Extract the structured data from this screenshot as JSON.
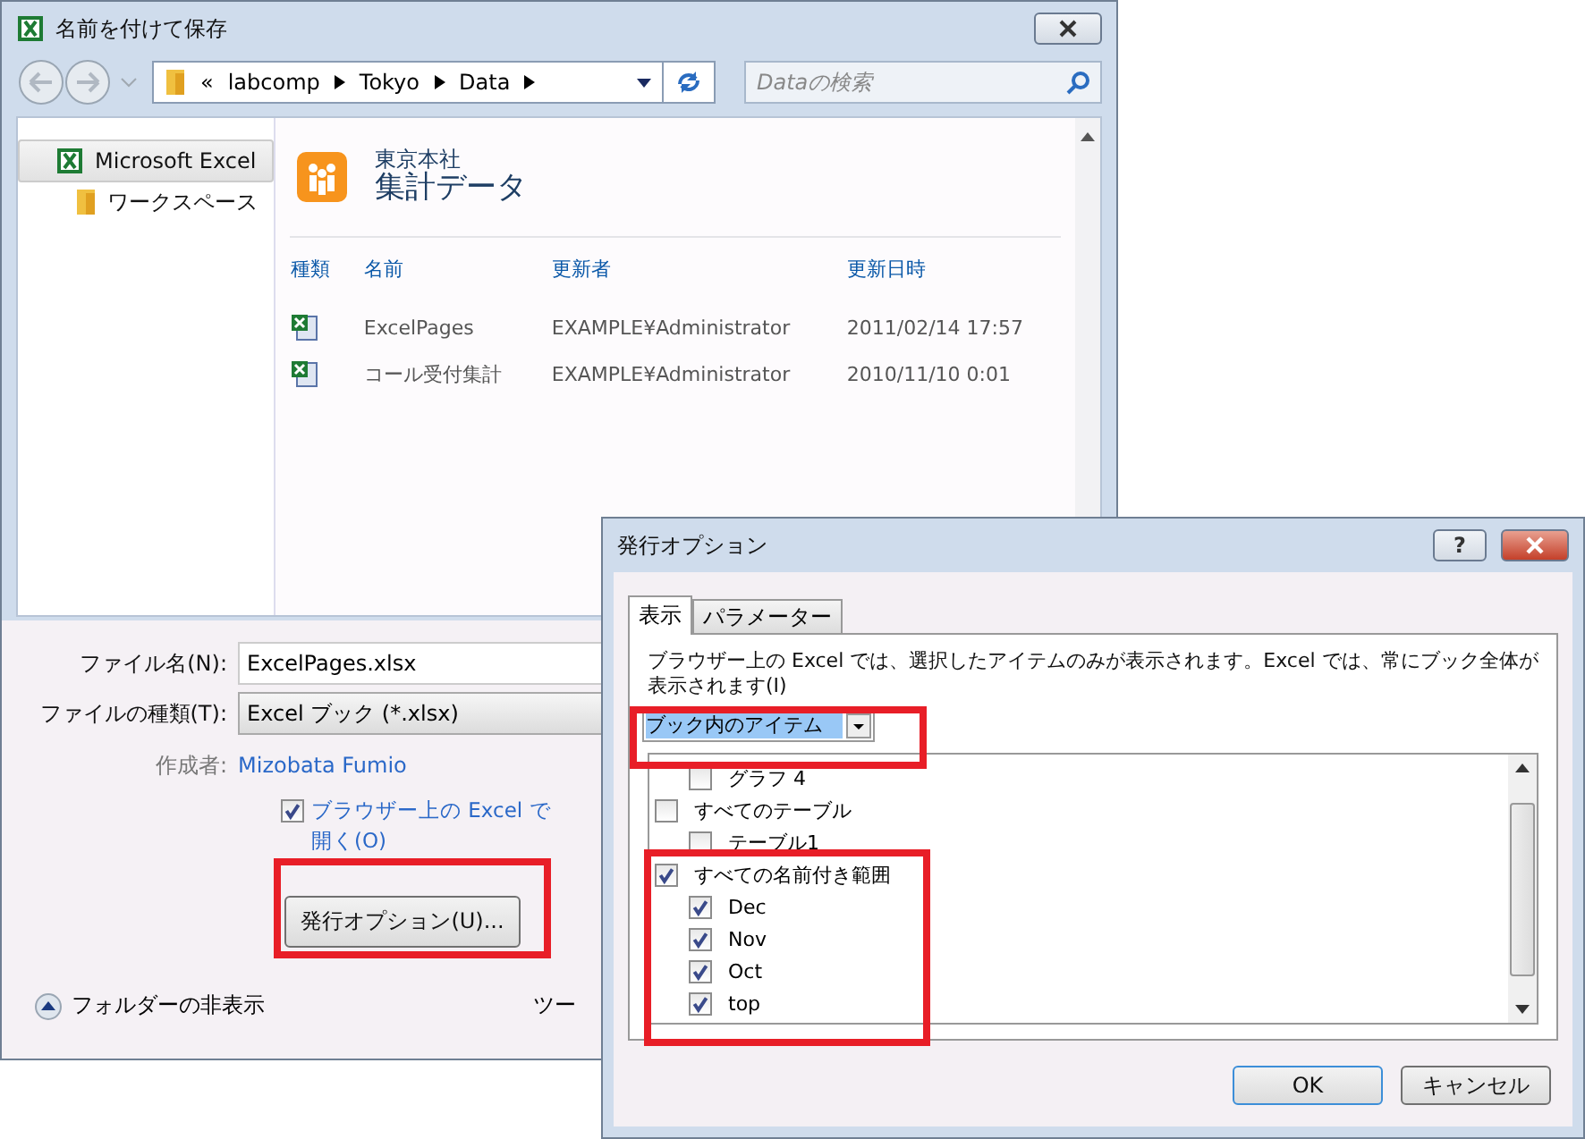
{
  "save_dialog": {
    "title": "名前を付けて保存",
    "breadcrumb": [
      "«",
      "labcomp",
      "Tokyo",
      "Data"
    ],
    "search": {
      "placeholder": "Dataの検索"
    },
    "sidebar": {
      "items": [
        {
          "label": "Microsoft Excel",
          "selected": true,
          "kind": "app"
        },
        {
          "label": "ワークスペース",
          "selected": false,
          "kind": "folder"
        }
      ]
    },
    "site": {
      "subtitle": "東京本社",
      "title": "集計データ"
    },
    "table": {
      "columns": [
        "種類",
        "名前",
        "更新者",
        "更新日時"
      ],
      "rows": [
        {
          "name": "ExcelPages",
          "author": "EXAMPLE¥Administrator",
          "modified": "2011/02/14 17:57"
        },
        {
          "name": "コール受付集計",
          "author": "EXAMPLE¥Administrator",
          "modified": "2010/11/10 0:01"
        }
      ]
    },
    "file_name": {
      "label": "ファイル名(N):",
      "value": "ExcelPages.xlsx"
    },
    "file_type": {
      "label": "ファイルの種類(T):",
      "value": "Excel ブック (*.xlsx)"
    },
    "author": {
      "label": "作成者:",
      "value": "Mizobata Fumio"
    },
    "open_in_browser": {
      "label": "ブラウザー上の Excel で開く(O)",
      "checked": true
    },
    "publish_button": "発行オプション(U)...",
    "hide_folders": "フォルダーの非表示",
    "tools_partial": "ツー"
  },
  "publish_dialog": {
    "title": "発行オプション",
    "help": "?",
    "tabs": [
      {
        "label": "表示",
        "selected": true
      },
      {
        "label": "パラメーター",
        "selected": false
      }
    ],
    "description": "ブラウザー上の Excel では、選択したアイテムのみが表示されます。Excel では、常にブック全体が表示されます(I)",
    "dropdown": "ブック内のアイテム",
    "items": [
      {
        "children": [
          {
            "label": "グラフ 4",
            "checked": false
          }
        ]
      },
      {
        "label": "すべてのテーブル",
        "checked": false,
        "children": [
          {
            "label": "テーブル1",
            "checked": false
          }
        ]
      },
      {
        "label": "すべての名前付き範囲",
        "checked": true,
        "children": [
          {
            "label": "Dec",
            "checked": true
          },
          {
            "label": "Nov",
            "checked": true
          },
          {
            "label": "Oct",
            "checked": true
          },
          {
            "label": "top",
            "checked": true
          }
        ]
      }
    ],
    "buttons": [
      "OK",
      "キャンセル"
    ]
  }
}
